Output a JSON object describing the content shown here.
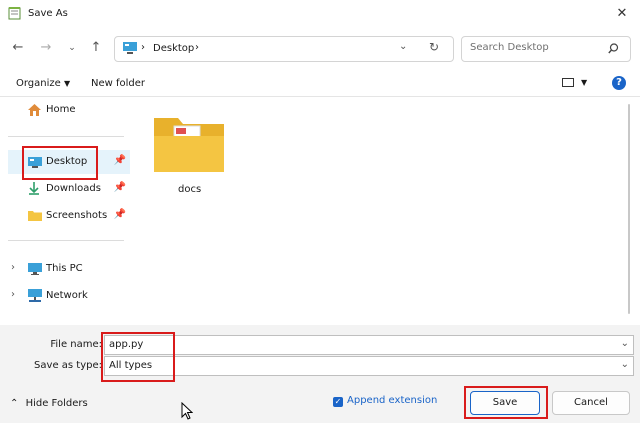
{
  "window": {
    "title": "Save As",
    "icon": "notepad-icon"
  },
  "nav": {
    "back_icon": "arrow-left-icon",
    "forward_icon": "arrow-right-icon",
    "recent_icon": "chevron-down-icon",
    "up_icon": "arrow-up-icon",
    "breadcrumb": [
      "Desktop"
    ],
    "refresh_icon": "refresh-icon",
    "search_placeholder": "Search Desktop"
  },
  "toolbar": {
    "organize": "Organize",
    "new_folder": "New folder"
  },
  "sidebar": {
    "quick": [
      {
        "label": "Home",
        "icon": "home-icon"
      },
      {
        "label": "Desktop",
        "icon": "desktop-icon",
        "selected": true,
        "pinned": true
      },
      {
        "label": "Downloads",
        "icon": "download-icon",
        "pinned": true
      },
      {
        "label": "Screenshots",
        "icon": "folder-icon",
        "pinned": true
      }
    ],
    "tree": [
      {
        "label": "This PC",
        "icon": "monitor-icon"
      },
      {
        "label": "Network",
        "icon": "network-icon"
      }
    ]
  },
  "files": [
    {
      "name": "docs",
      "icon": "folder-icon"
    }
  ],
  "form": {
    "file_name_label": "File name:",
    "file_name_value": "app.py",
    "type_label": "Save as type:",
    "type_value": "All types",
    "append_extension": "Append extension",
    "append_checked": true
  },
  "footer": {
    "hide_folders": "Hide Folders",
    "save": "Save",
    "cancel": "Cancel"
  },
  "colors": {
    "accent": "#1a64c8",
    "highlight": "#d91b1b",
    "folder": "#f4c542"
  }
}
